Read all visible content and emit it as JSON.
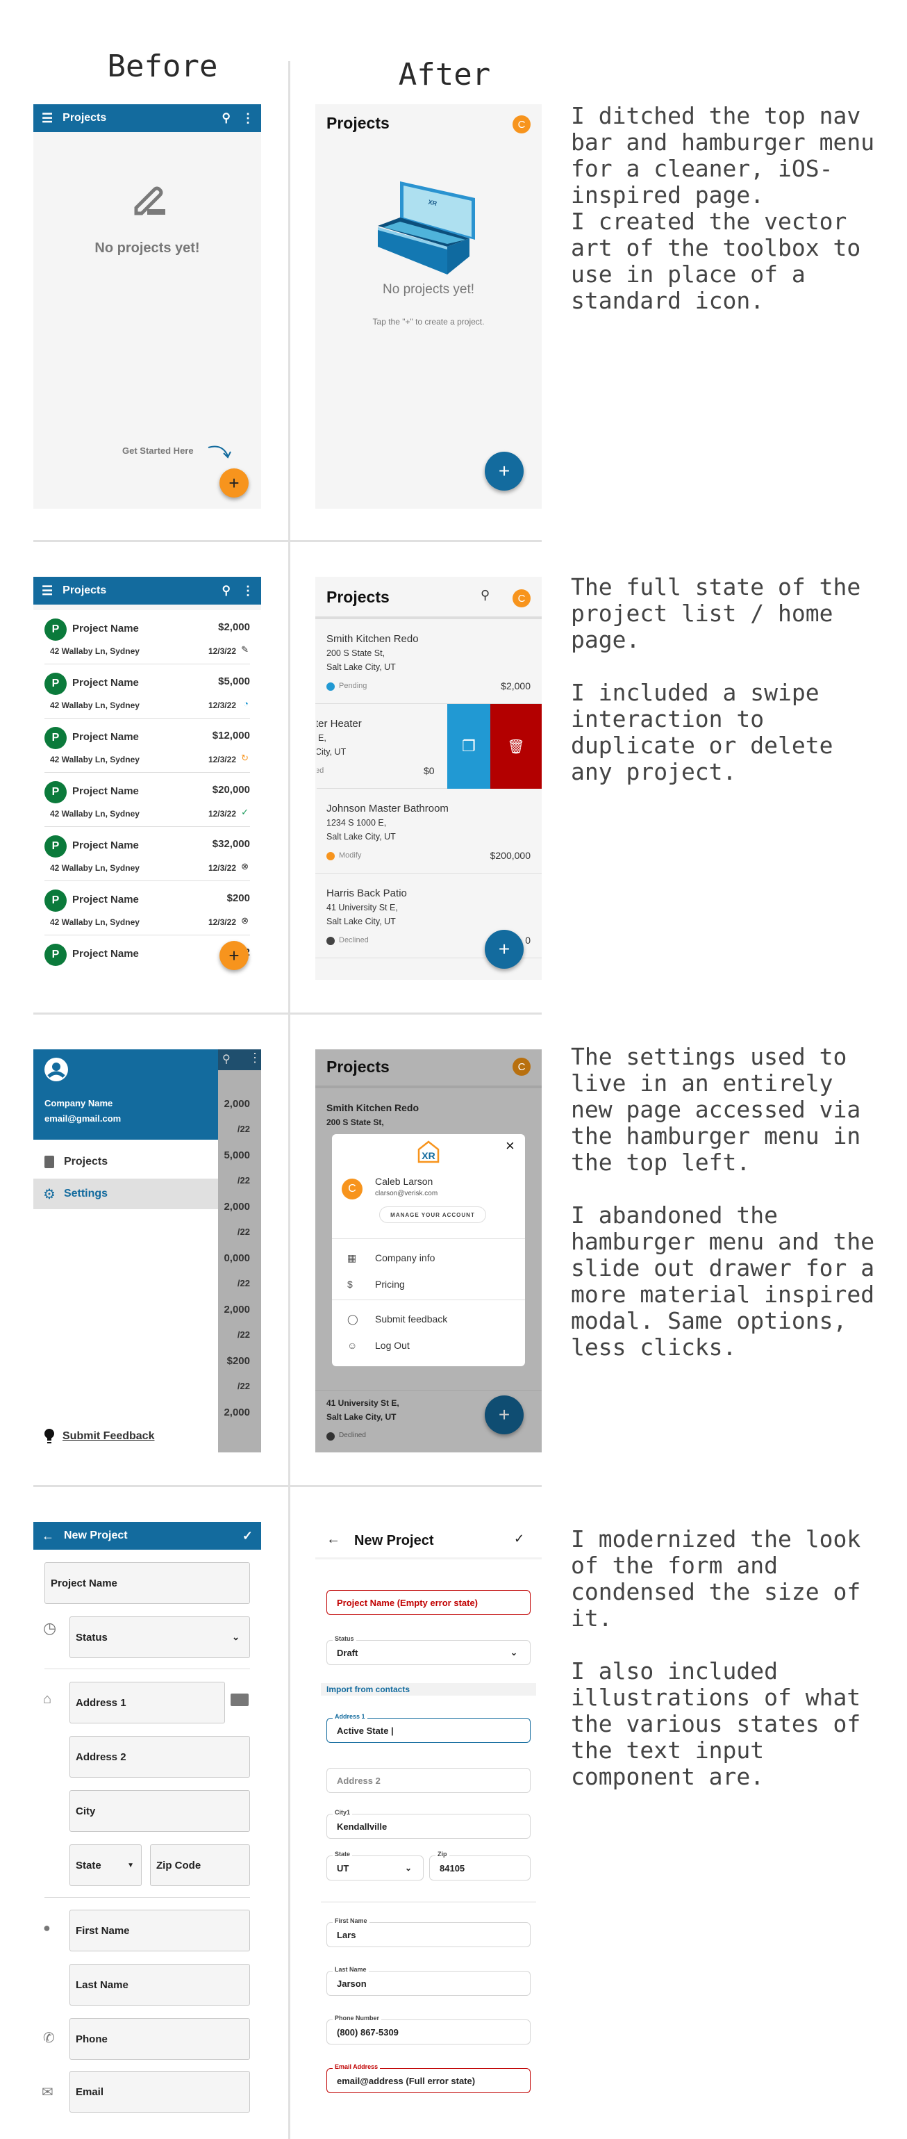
{
  "headings": {
    "before": "Before",
    "after": "After"
  },
  "colors": {
    "brand_blue": "#136b9e",
    "accent_orange": "#f7941d",
    "avatar_green": "#0b7a3b",
    "duplicate_blue": "#2199d3",
    "delete_red": "#b30000",
    "error_red": "#c00000",
    "panel_bg": "#f5f5f5"
  },
  "notes": {
    "s1": "I ditched the top nav\nbar and hamburger menu\nfor a cleaner, iOS-\ninspired page.\nI created the vector\nart of the toolbox to\nuse in place of a\nstandard icon.",
    "s2": "The full state of the\nproject list / home\npage.\n\nI included a swipe\ninteraction to\nduplicate or delete\nany project.",
    "s3": "The settings used to\nlive in an entirely\nnew page accessed via\nthe hamburger menu in\nthe top left.\n\nI abandoned the\nhamburger menu and the\nslide out drawer for a\nmore material inspired\nmodal. Same options,\nless clicks.",
    "s4": "I modernized the look\nof the form and\ncondensed the size of\nit.\n\nI also included\nillustrations of what\nthe various states of\nthe text input\ncomponent are."
  },
  "s1": {
    "before": {
      "title": "Projects",
      "empty": "No projects yet!",
      "hint": "Get Started Here",
      "empty_icon": "pencil-icon"
    },
    "after": {
      "title": "Projects",
      "avatar": "C",
      "empty": "No projects yet!",
      "sub": "Tap the \"+\" to create a project.",
      "box_logo": "XR"
    }
  },
  "s2": {
    "before": {
      "title": "Projects",
      "rows": [
        {
          "initial": "P",
          "name": "Project Name",
          "price": "$2,000",
          "address": "42 Wallaby Ln, Sydney",
          "date": "12/3/22",
          "status_icon": "pencil-icon"
        },
        {
          "initial": "P",
          "name": "Project Name",
          "price": "$5,000",
          "address": "42 Wallaby Ln, Sydney",
          "date": "12/3/22",
          "status_icon": "clock-icon"
        },
        {
          "initial": "P",
          "name": "Project Name",
          "price": "$12,000",
          "address": "42 Wallaby Ln, Sydney",
          "date": "12/3/22",
          "status_icon": "refresh-icon"
        },
        {
          "initial": "P",
          "name": "Project Name",
          "price": "$20,000",
          "address": "42 Wallaby Ln, Sydney",
          "date": "12/3/22",
          "status_icon": "check-icon"
        },
        {
          "initial": "P",
          "name": "Project Name",
          "price": "$32,000",
          "address": "42 Wallaby Ln, Sydney",
          "date": "12/3/22",
          "status_icon": "x-circle-icon"
        },
        {
          "initial": "P",
          "name": "Project Name",
          "price": "$200",
          "address": "42 Wallaby Ln, Sydney",
          "date": "12/3/22",
          "status_icon": "x-circle-icon"
        },
        {
          "initial": "P",
          "name": "Project Name",
          "price": "$2",
          "address": "",
          "date": "",
          "status_icon": ""
        }
      ]
    },
    "after": {
      "title": "Projects",
      "avatar": "C",
      "cards": [
        {
          "title": "Smith Kitchen Redo",
          "line1": "200 S State St,",
          "line2": "Salt Lake City, UT",
          "status": "Pending",
          "status_icon": "clock-icon",
          "price": "$2,000"
        },
        {
          "title": "ter Heater",
          "line1": "E,",
          "line2": "City, UT",
          "status": "ed",
          "status_icon": "",
          "price": "$0",
          "swiped": true
        },
        {
          "title": "Johnson Master Bathroom",
          "line1": "1234 S 1000 E,",
          "line2": "Salt Lake City, UT",
          "status": "Modify",
          "status_icon": "refresh-icon",
          "price": "$200,000"
        },
        {
          "title": "Harris Back Patio",
          "line1": "41 University St E,",
          "line2": "Salt Lake City, UT",
          "status": "Declined",
          "status_icon": "x-circle-icon",
          "price": "0"
        }
      ]
    }
  },
  "s3": {
    "before": {
      "company": "Company Name",
      "email": "email@gmail.com",
      "menu": [
        {
          "label": "Projects",
          "icon": "clipboard-icon"
        },
        {
          "label": "Settings",
          "icon": "gear-icon",
          "selected": true
        }
      ],
      "feedback": "Submit Feedback",
      "behind": [
        "2,000",
        "/22",
        "5,000",
        "/22",
        "2,000",
        "/22",
        "0,000",
        "/22",
        "2,000",
        "/22",
        "$200",
        "/22",
        "2,000"
      ]
    },
    "after": {
      "title": "Projects",
      "avatar": "C",
      "behind": {
        "card1_title": "Smith Kitchen Redo",
        "card1_line1": "200 S State St,",
        "card4_line1": "41 University St E,",
        "card4_line2": "Salt Lake City, UT",
        "card4_status": "Declined"
      },
      "modal": {
        "logo": "XR",
        "avatar": "C",
        "name": "Caleb Larson",
        "email": "clarson@verisk.com",
        "manage": "MANAGE YOUR ACCOUNT",
        "items": [
          {
            "label": "Company info",
            "icon": "building-icon"
          },
          {
            "label": "Pricing",
            "icon": "dollar-icon"
          },
          {
            "label": "Submit feedback",
            "icon": "lightbulb-icon"
          },
          {
            "label": "Log Out",
            "icon": "account-circle-icon"
          }
        ]
      }
    }
  },
  "s4": {
    "before": {
      "title": "New Project",
      "fields": {
        "project_name": "Project Name",
        "status": "Status",
        "address1": "Address 1",
        "address2": "Address 2",
        "city": "City",
        "state": "State",
        "zip": "Zip Code",
        "first": "First Name",
        "last": "Last Name",
        "phone": "Phone",
        "email": "Email"
      }
    },
    "after": {
      "title": "New Project",
      "import": "Import from contacts",
      "project_name": "Project Name (Empty error state)",
      "status": {
        "label": "Status",
        "value": "Draft"
      },
      "address1": {
        "label": "Address 1",
        "value": "Active State |"
      },
      "address2": {
        "placeholder": "Address 2"
      },
      "city": {
        "label": "City1",
        "value": "Kendallville"
      },
      "state": {
        "label": "State",
        "value": "UT"
      },
      "zip": {
        "label": "Zip",
        "value": "84105"
      },
      "first": {
        "label": "First Name",
        "value": "Lars"
      },
      "last": {
        "label": "Last Name",
        "value": "Jarson"
      },
      "phone": {
        "label": "Phone Number",
        "value": "(800) 867-5309"
      },
      "email": {
        "label": "Email Address",
        "value": "email@address (Full error state)"
      }
    }
  }
}
